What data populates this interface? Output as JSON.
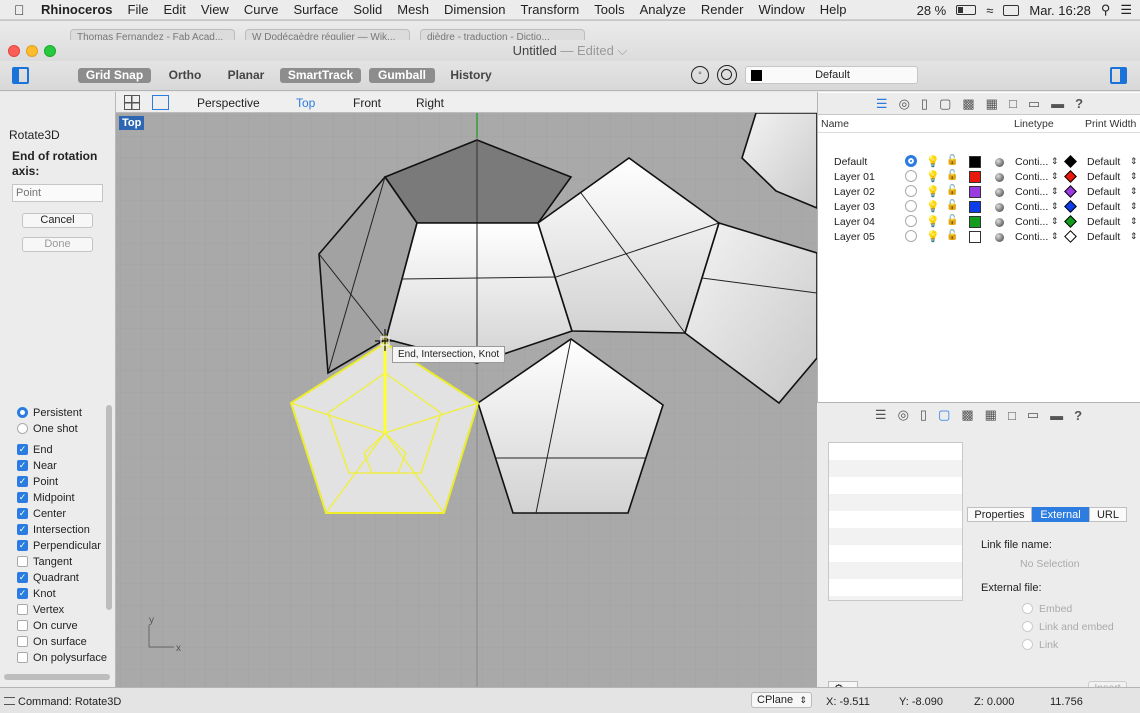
{
  "menubar": {
    "app": "Rhinoceros",
    "items": [
      "File",
      "Edit",
      "View",
      "Curve",
      "Surface",
      "Solid",
      "Mesh",
      "Dimension",
      "Transform",
      "Tools",
      "Analyze",
      "Render",
      "Window",
      "Help"
    ],
    "battery": "28 %",
    "clock": "Mar. 16:28"
  },
  "window": {
    "title": "Untitled",
    "subtitle": "— Edited ⌵",
    "browser_tabs": [
      "Thomas Fernandez - Fab Acad...",
      "W Dodécaèdre régulier — Wik...",
      "dièdre - traduction - Dictio..."
    ]
  },
  "toolbar": {
    "grid_snap": "Grid Snap",
    "ortho": "Ortho",
    "planar": "Planar",
    "smarttrack": "SmartTrack",
    "gumball": "Gumball",
    "history": "History",
    "layer": "Default"
  },
  "viewport_tabs": [
    "Perspective",
    "Top",
    "Front",
    "Right"
  ],
  "viewport": {
    "label": "Top",
    "snap_tip": "End, Intersection, Knot",
    "axis_y": "y",
    "axis_x": "x"
  },
  "command": {
    "name": "Rotate3D",
    "prompt": "End of rotation axis:",
    "input_placeholder": "Point",
    "cancel": "Cancel",
    "done": "Done"
  },
  "osnap": {
    "modes": [
      {
        "label": "Persistent",
        "type": "radio",
        "checked": true
      },
      {
        "label": "One shot",
        "type": "radio",
        "checked": false
      }
    ],
    "snaps": [
      {
        "label": "End",
        "checked": true
      },
      {
        "label": "Near",
        "checked": true
      },
      {
        "label": "Point",
        "checked": true
      },
      {
        "label": "Midpoint",
        "checked": true
      },
      {
        "label": "Center",
        "checked": true
      },
      {
        "label": "Intersection",
        "checked": true
      },
      {
        "label": "Perpendicular",
        "checked": true
      },
      {
        "label": "Tangent",
        "checked": false
      },
      {
        "label": "Quadrant",
        "checked": true
      },
      {
        "label": "Knot",
        "checked": true
      },
      {
        "label": "Vertex",
        "checked": false
      },
      {
        "label": "On curve",
        "checked": false
      },
      {
        "label": "On surface",
        "checked": false
      },
      {
        "label": "On polysurface",
        "checked": false
      }
    ]
  },
  "layers": {
    "headers": {
      "name": "Name",
      "linetype": "Linetype",
      "print_width": "Print Width"
    },
    "rows": [
      {
        "name": "Default",
        "current": true,
        "color": "#000000",
        "linetype": "Conti...",
        "print_color": "#000000",
        "print_width": "Default"
      },
      {
        "name": "Layer 01",
        "current": false,
        "color": "#e8180c",
        "linetype": "Conti...",
        "print_color": "#e8180c",
        "print_width": "Default"
      },
      {
        "name": "Layer 02",
        "current": false,
        "color": "#9a3be0",
        "linetype": "Conti...",
        "print_color": "#9a3be0",
        "print_width": "Default"
      },
      {
        "name": "Layer 03",
        "current": false,
        "color": "#0c3de8",
        "linetype": "Conti...",
        "print_color": "#0c3de8",
        "print_width": "Default"
      },
      {
        "name": "Layer 04",
        "current": false,
        "color": "#139c1e",
        "linetype": "Conti...",
        "print_color": "#139c1e",
        "print_width": "Default"
      },
      {
        "name": "Layer 05",
        "current": false,
        "color": "#ffffff",
        "linetype": "Conti...",
        "print_color": "#ffffff",
        "print_width": "Default"
      }
    ]
  },
  "properties": {
    "tabs": [
      "Properties",
      "External",
      "URL"
    ],
    "active_tab": "External",
    "link_file_label": "Link file name:",
    "no_selection": "No Selection",
    "external_file_label": "External file:",
    "options": [
      "Embed",
      "Link and embed",
      "Link"
    ],
    "insert": "Insert"
  },
  "status": {
    "command": "Command: Rotate3D",
    "cplane": "CPlane",
    "x": "X: -9.511",
    "y": "Y: -8.090",
    "z": "Z: 0.000",
    "distance": "11.756"
  },
  "colors": {
    "accent": "#2a7ce0",
    "selection": "#f2f23a"
  }
}
